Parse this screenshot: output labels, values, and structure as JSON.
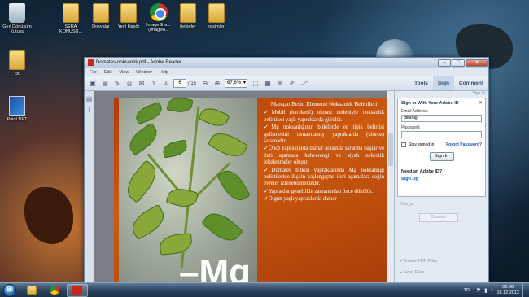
{
  "desktop": {
    "icons": [
      {
        "label": "Geri Dönüşüm Kutusu",
        "icon": "recycle-bin-icon"
      },
      {
        "label": "SERA KONUSU...",
        "icon": "folder-icon"
      },
      {
        "label": "Dosyalar",
        "icon": "folder-icon"
      },
      {
        "label": "Yeni klasör",
        "icon": "folder-icon"
      },
      {
        "label": "ImageSha... (ImageH...",
        "icon": "chrome-icon"
      },
      {
        "label": "belgeler",
        "icon": "folder-icon"
      },
      {
        "label": "resimler",
        "icon": "folder-icon"
      },
      {
        "label": "ck",
        "icon": "folder-icon"
      },
      {
        "label": "Paint.NET",
        "icon": "paintnet-icon"
      }
    ]
  },
  "window": {
    "title": "Domates-noksanlık.pdf - Adobe Reader",
    "controls": {
      "minimize": "–",
      "maximize": "□",
      "close": "✕"
    },
    "menu": [
      "File",
      "Edit",
      "View",
      "Window",
      "Help"
    ],
    "toolbar": {
      "current_page": "6",
      "total_pages": "/ 15",
      "zoom": "67,6%",
      "right_tabs": [
        "Tools",
        "Sign",
        "Comment"
      ],
      "selected_tab": "Sign"
    }
  },
  "document": {
    "image_caption": "–Mg",
    "heading": "Mangan Besin Elementi Noksanlık Belirtileri",
    "bullets": [
      "Mobil (hareketli) olması nedeniyle noksanlık belirtileri yaşlı yapraklarda görülür.",
      "Mg noksanlığının bitkilerde en tipik belirtisi gelişmesini tamamlamış yapraklarda (kloroz) saramadır.",
      "Önce yapraklarda damar arasında sararma başlar ve ileri aşamada kahverengi ve siyah nekrotik lekelenmeler oluşur.",
      "Domates bitkisi yapraklarında Mg noksanlığı belirtilerine ilişkin başlangıçtan ileri aşamalara değin evreler izlenebilmektedir.",
      "Yapraklar genellikle zamanından önce dökülür.",
      "Olgun yaşlı yapraklarda damar"
    ]
  },
  "sign_panel": {
    "top_link": "Sign In",
    "title": "Sign In With Your Adobe ID",
    "email_label": "Email Address:",
    "email_value": "dtkarag",
    "password_label": "Password:",
    "stay_signed_in": "Stay signed in",
    "forgot_password": "Forgot Password?",
    "sign_in_button": "Sign In",
    "need_id": "Need an Adobe ID?",
    "sign_up": "Sign Up",
    "muted_text": "Change",
    "convert_button": "Convert",
    "accordions": [
      "Create PDF Files",
      "Send Files"
    ]
  },
  "taskbar": {
    "language": "TR",
    "time": "03:56",
    "date": "18.12.2012"
  }
}
